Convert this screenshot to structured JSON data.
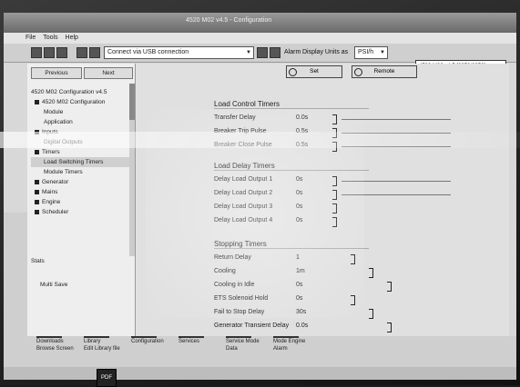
{
  "window": {
    "title": "4520 M02 v4.5 - Configuration",
    "menu": [
      "File",
      "Tools",
      "Help"
    ]
  },
  "toolbar": {
    "connection": "Connect via USB connection",
    "alarm_label": "Alarm",
    "display_label": "Display Units as",
    "display_value": "PSI/h",
    "controller": "4520 M02 v4.5 [2352/2356]"
  },
  "left_panel": {
    "nav_prev": "Previous",
    "nav_next": "Next",
    "tree": [
      {
        "label": "4520 M02 Configuration v4.5",
        "selected": false,
        "square": false
      },
      {
        "label": "4520 M02 Configuration",
        "selected": false,
        "square": true
      },
      {
        "label": "Module",
        "selected": false,
        "square": false
      },
      {
        "label": "Application",
        "selected": false,
        "square": false
      },
      {
        "label": "Inputs",
        "selected": false,
        "square": true
      },
      {
        "label": "Digital Outputs",
        "selected": false,
        "square": false
      },
      {
        "label": "Timers",
        "selected": false,
        "square": true
      },
      {
        "label": "Load Switching Timers",
        "selected": true,
        "square": false
      },
      {
        "label": "Module Timers",
        "selected": false,
        "square": false
      },
      {
        "label": "Generator",
        "selected": false,
        "square": true
      },
      {
        "label": "Mains",
        "selected": false,
        "square": true
      },
      {
        "label": "Engine",
        "selected": false,
        "square": true
      },
      {
        "label": "Scheduler",
        "selected": false,
        "square": true
      }
    ],
    "stats_label": "Stats",
    "bottom_text": "Multi  Save"
  },
  "main": {
    "tab_set": "Set",
    "tab_remote": "Remote",
    "sections": [
      {
        "title": "Load Control Timers",
        "rows": [
          {
            "label": "Transfer Delay",
            "value": "0.0s",
            "slider": true
          },
          {
            "label": "Breaker Trip Pulse",
            "value": "0.5s",
            "slider": true
          },
          {
            "label": "Breaker Close Pulse",
            "value": "0.5s",
            "slider": true
          }
        ]
      },
      {
        "title": "Load Delay Timers",
        "rows": [
          {
            "label": "Delay Load Output 1",
            "value": "0s",
            "slider": true
          },
          {
            "label": "Delay Load Output 2",
            "value": "0s",
            "slider": true
          },
          {
            "label": "Delay Load Output 3",
            "value": "0s",
            "slider": false
          },
          {
            "label": "Delay Load Output 4",
            "value": "0s",
            "slider": false
          }
        ]
      },
      {
        "title": "Stopping Timers",
        "rows": [
          {
            "label": "Return Delay",
            "value": "1",
            "slider": false
          },
          {
            "label": "Cooling",
            "value": "1m",
            "slider": false
          },
          {
            "label": "Cooling in Idle",
            "value": "0s",
            "slider": false
          },
          {
            "label": "ETS Solenoid Hold",
            "value": "0s",
            "slider": false
          },
          {
            "label": "Fail to Stop Delay",
            "value": "30s",
            "slider": false
          },
          {
            "label": "Generator Transient Delay",
            "value": "0.0s",
            "slider": false
          }
        ]
      }
    ]
  },
  "taskbar": {
    "items": [
      "Downloads",
      "Library",
      "Configuration",
      "Services",
      "Service Mode",
      "Mode Engine"
    ],
    "sub_items": [
      "Browse Screen",
      "Edit Library file",
      "",
      "",
      "Data",
      "Alarm"
    ]
  },
  "bottom": {
    "pdf_label": "PDF"
  }
}
